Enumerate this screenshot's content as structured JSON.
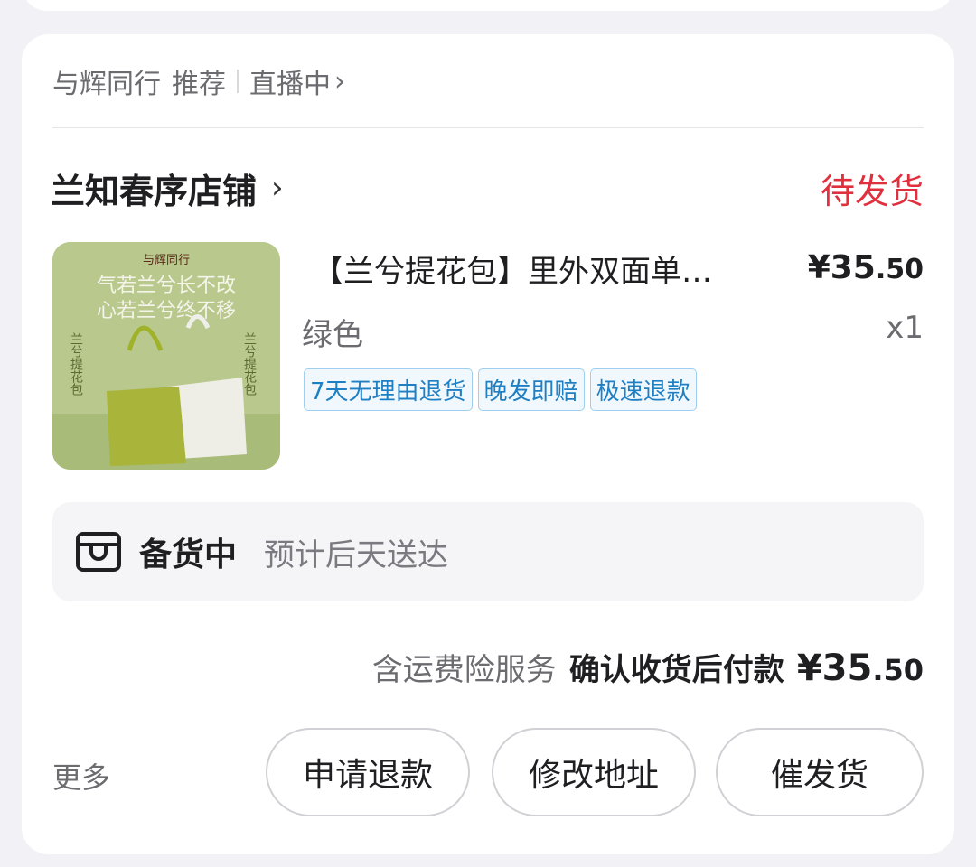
{
  "source": {
    "channel": "与辉同行",
    "tag": "推荐",
    "live": "直播中"
  },
  "shop": {
    "name": "兰知春序店铺",
    "status": "待发货"
  },
  "product": {
    "title": "【兰兮提花包】里外双面单…",
    "price_main": "¥35",
    "price_decimal": ".50",
    "variant": "绿色",
    "quantity": "x1",
    "tags": [
      "7天无理由退货",
      "晚发即赔",
      "极速退款"
    ],
    "image": {
      "brand": "与辉同行",
      "line1": "气若兰兮长不改",
      "line2": "心若兰兮终不移",
      "side_left": "兰兮提花包",
      "side_right": "兰兮提花包"
    }
  },
  "shipping": {
    "status": "备货中",
    "eta": "预计后天送达"
  },
  "payment": {
    "insurance": "含运费险服务",
    "mode": "确认收货后付款",
    "amount_main": "¥35",
    "amount_decimal": ".50"
  },
  "actions": {
    "more": "更多",
    "refund": "申请退款",
    "change_address": "修改地址",
    "urge": "催发货"
  },
  "colors": {
    "status_red": "#e0303e",
    "tag_blue": "#1f7fc3"
  }
}
